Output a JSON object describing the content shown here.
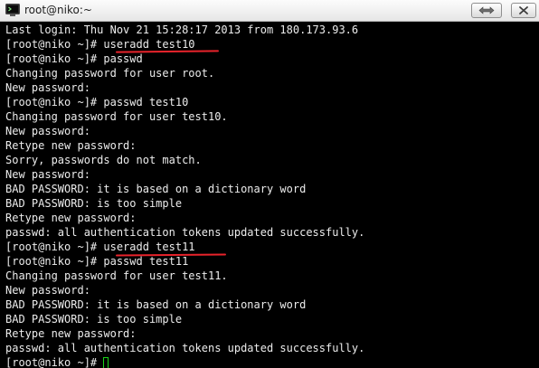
{
  "window": {
    "title": "root@niko:~"
  },
  "colors": {
    "background": "#000000",
    "text": "#ececec",
    "annotation": "#e8232b",
    "cursor": "#19d419"
  },
  "titlebar_buttons": [
    {
      "name": "restore",
      "icon": "restore-arrows-icon"
    },
    {
      "name": "close",
      "icon": "close-icon"
    }
  ],
  "terminal": {
    "lines": [
      "Last login: Thu Nov 21 15:28:17 2013 from 180.173.93.6",
      "[root@niko ~]# useradd test10",
      "[root@niko ~]# passwd",
      "Changing password for user root.",
      "New password:",
      "[root@niko ~]# passwd test10",
      "Changing password for user test10.",
      "New password:",
      "Retype new password:",
      "Sorry, passwords do not match.",
      "New password:",
      "BAD PASSWORD: it is based on a dictionary word",
      "BAD PASSWORD: is too simple",
      "Retype new password:",
      "passwd: all authentication tokens updated successfully.",
      "[root@niko ~]# useradd test11",
      "[root@niko ~]# passwd test11",
      "Changing password for user test11.",
      "New password:",
      "BAD PASSWORD: it is based on a dictionary word",
      "BAD PASSWORD: is too simple",
      "Retype new password:",
      "passwd: all authentication tokens updated successfully."
    ],
    "prompt": "[root@niko ~]# "
  }
}
